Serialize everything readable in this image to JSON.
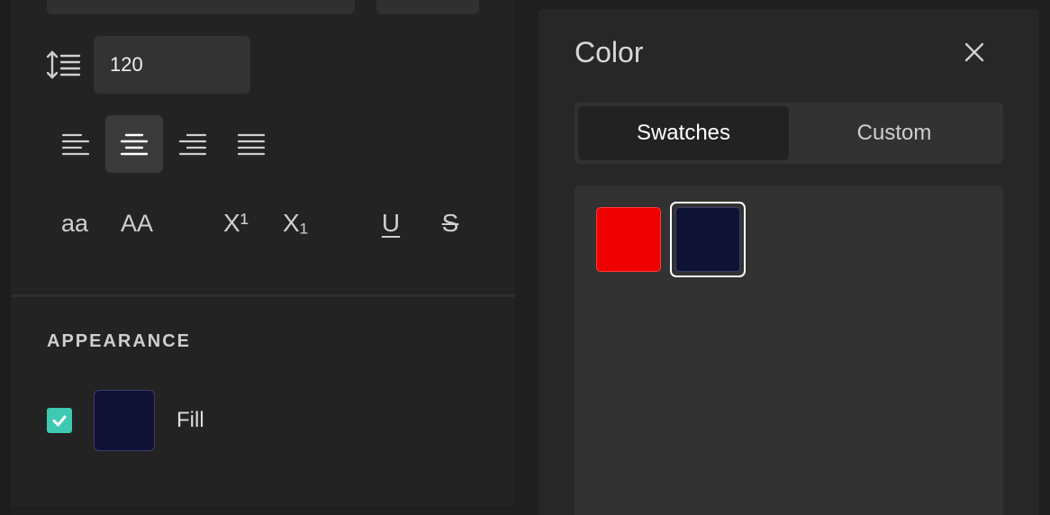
{
  "text_panel": {
    "line_height_value": "120",
    "case_lower_label": "aa",
    "case_upper_label": "AA",
    "superscript_label": "X¹",
    "subscript_label": "X₁",
    "underline_label": "U",
    "strikethrough_label": "S"
  },
  "appearance": {
    "section_title": "APPEARANCE",
    "fill_label": "Fill",
    "fill_color": "#0f1135",
    "fill_checked": true
  },
  "color_panel": {
    "title": "Color",
    "tabs": [
      {
        "label": "Swatches",
        "active": true
      },
      {
        "label": "Custom",
        "active": false
      }
    ],
    "swatches": [
      {
        "color": "#ee0000",
        "selected": false
      },
      {
        "color": "#0f1135",
        "selected": true
      }
    ]
  },
  "colors": {
    "accent_check": "#3ec9b2",
    "panel_bg": "#232323",
    "input_bg": "#333333"
  }
}
